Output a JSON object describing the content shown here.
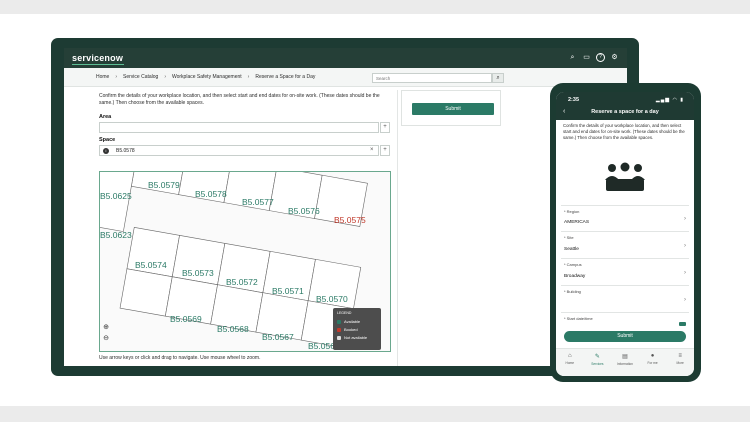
{
  "app": {
    "logo": "servicenow"
  },
  "breadcrumbs": [
    "Home",
    "Service Catalog",
    "Workplace Safety Management",
    "Reserve a Space for a Day"
  ],
  "search": {
    "placeholder": "Search"
  },
  "form": {
    "intro": "Confirm the details of your workplace location, and then select start and end dates for on-site work. (These dates should be the same.) Then choose from the available spaces.",
    "area_label": "Area",
    "area_value": "",
    "space_label": "Space",
    "space_value": "B5.0578",
    "clear_glyph": "×",
    "add_glyph": "+"
  },
  "submit_label": "Submit",
  "map": {
    "rooms": [
      {
        "label": "B5.0579",
        "status": "available"
      },
      {
        "label": "B5.0578",
        "status": "available"
      },
      {
        "label": "B5.0577",
        "status": "available"
      },
      {
        "label": "B5.0576",
        "status": "available"
      },
      {
        "label": "B5.0575",
        "status": "booked"
      },
      {
        "label": "B5.0625",
        "status": "available"
      },
      {
        "label": "B5.0623",
        "status": "available"
      },
      {
        "label": "B5.0574",
        "status": "available"
      },
      {
        "label": "B5.0573",
        "status": "available"
      },
      {
        "label": "B5.0572",
        "status": "available"
      },
      {
        "label": "B5.0571",
        "status": "available"
      },
      {
        "label": "B5.0570",
        "status": "available"
      },
      {
        "label": "B5.0569",
        "status": "available"
      },
      {
        "label": "B5.0568",
        "status": "available"
      },
      {
        "label": "B5.0567",
        "status": "available"
      },
      {
        "label": "B5.0566",
        "status": "available"
      }
    ],
    "legend": {
      "title": "LEGEND",
      "items": [
        {
          "label": "Available",
          "color": "#2b7a66"
        },
        {
          "label": "Booked",
          "color": "#c0392b"
        },
        {
          "label": "Not available",
          "color": "#dddddd"
        }
      ]
    },
    "help": "Use arrow keys or click and drag to navigate. Use mouse wheel to zoom.",
    "zoom_in": "⊕",
    "zoom_out": "⊖"
  },
  "phone": {
    "time": "2:35",
    "status": "▂▄▆ ◠ ▮",
    "title": "Reserve a space for a day",
    "intro": "Confirm the details of your workplace location, and then select start and end dates for on-site work. (These dates should be the same.) Then choose from the available spaces.",
    "fields": [
      {
        "label": "* Region",
        "value": "AMERICAS"
      },
      {
        "label": "* Site",
        "value": "Seattle"
      },
      {
        "label": "* Campus",
        "value": "Broadway"
      },
      {
        "label": "* Building",
        "value": ""
      },
      {
        "label": "* Start date/time",
        "value": ""
      }
    ],
    "submit": "Submit",
    "nav": [
      {
        "label": "Home",
        "icon": "home-icon",
        "active": false
      },
      {
        "label": "Services",
        "icon": "services-icon",
        "active": true
      },
      {
        "label": "Information",
        "icon": "document-icon",
        "active": false
      },
      {
        "label": "For me",
        "icon": "user-icon",
        "active": false
      },
      {
        "label": "More",
        "icon": "menu-icon",
        "active": false
      }
    ]
  },
  "colors": {
    "brand_dark": "#253f37",
    "accent": "#2b7a66",
    "booked": "#c0392b"
  }
}
